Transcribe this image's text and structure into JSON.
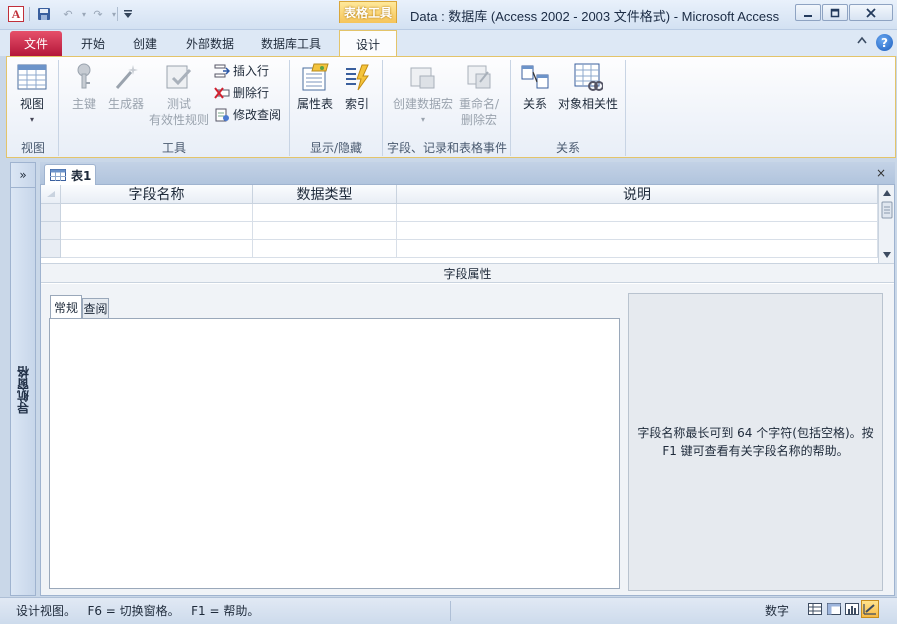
{
  "quick_access": {
    "app_icon": "access-icon",
    "undo_arrow": "▾",
    "redo_arrow": "▾"
  },
  "title": {
    "context_tab": "表格工具",
    "window_title": "Data : 数据库 (Access 2002 - 2003 文件格式)  -  Microsoft Access"
  },
  "window_controls": {
    "minimize": "minimize-icon",
    "maximize": "maximize-icon",
    "close": "close-icon"
  },
  "ribbon_tabs": [
    {
      "label": "文件"
    },
    {
      "label": "开始"
    },
    {
      "label": "创建"
    },
    {
      "label": "外部数据"
    },
    {
      "label": "数据库工具"
    },
    {
      "label": "设计"
    }
  ],
  "ribbon_groups": {
    "view": {
      "label": "视图",
      "view_button": "视图",
      "view_arrow": "▾"
    },
    "tools": {
      "label": "工具",
      "primary_key": "主键",
      "builder": "生成器",
      "test_rules_line1": "测试",
      "test_rules_line2": "有效性规则",
      "insert_row": "插入行",
      "delete_row": "删除行",
      "modify_lookup": "修改查阅"
    },
    "show_hide": {
      "label": "显示/隐藏",
      "property_sheet": "属性表",
      "indexes": "索引"
    },
    "events": {
      "label": "字段、记录和表格事件",
      "create_macro": "创建数据宏",
      "create_macro_arrow": "▾",
      "rename_macro_line1": "重命名/",
      "rename_macro_line2": "删除宏"
    },
    "relationships": {
      "label": "关系",
      "relationships_button": "关系",
      "dependencies_button": "对象相关性"
    }
  },
  "nav_pane": {
    "toggle": "»",
    "label": "导航窗格"
  },
  "document": {
    "tab_label": "表1",
    "close": "×",
    "columns": [
      "字段名称",
      "数据类型",
      "说明"
    ],
    "row_count": 3,
    "field_properties_label": "字段属性",
    "property_tabs": [
      "常规",
      "查阅"
    ],
    "help_text": "字段名称最长可到 64 个字符(包括空格)。按 F1 键可查看有关字段名称的帮助。"
  },
  "status_bar": {
    "text": "设计视图。   F6 = 切换窗格。   F1 = 帮助。",
    "mode": "数字"
  },
  "colors": {
    "file_tab": "#c9213f",
    "context_tab": "#f5c45a",
    "ribbon_border": "#e3c46a",
    "window_bg": "#c9d7e8"
  }
}
